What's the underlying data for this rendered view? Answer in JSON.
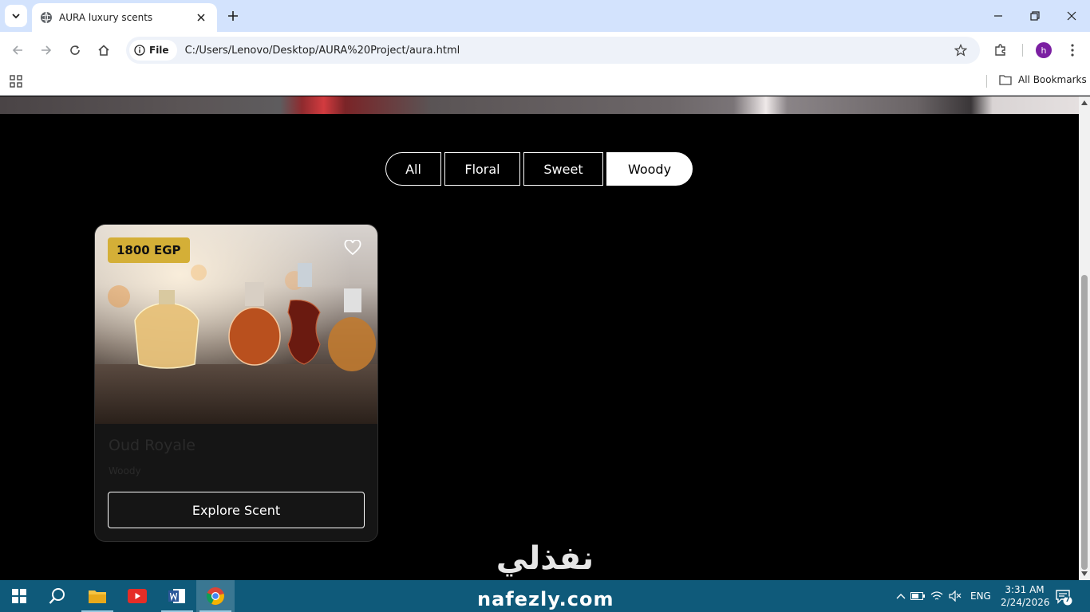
{
  "browser": {
    "tab_title": "AURA luxury scents",
    "site_chip_label": "File",
    "url": "C:/Users/Lenovo/Desktop/AURA%20Project/aura.html",
    "profile_initial": "h",
    "all_bookmarks_label": "All Bookmarks"
  },
  "filters": [
    {
      "label": "All",
      "active": false
    },
    {
      "label": "Floral",
      "active": false
    },
    {
      "label": "Sweet",
      "active": false
    },
    {
      "label": "Woody",
      "active": true
    }
  ],
  "product_card": {
    "price": "1800 EGP",
    "name": "Oud Royale",
    "category": "Woody",
    "button_label": "Explore Scent"
  },
  "watermark": {
    "arabic": "نفذلي",
    "latin": "nafezly.com"
  },
  "taskbar": {
    "language": "ENG",
    "time": "3:31 AM",
    "date": "2/24/2026",
    "notification_count": "7"
  },
  "colors": {
    "accent_gold": "#d4af37",
    "page_background": "#000000",
    "card_background": "#151515",
    "browser_tab_strip": "#d3e3fd",
    "taskbar": "#0f5a7a"
  }
}
